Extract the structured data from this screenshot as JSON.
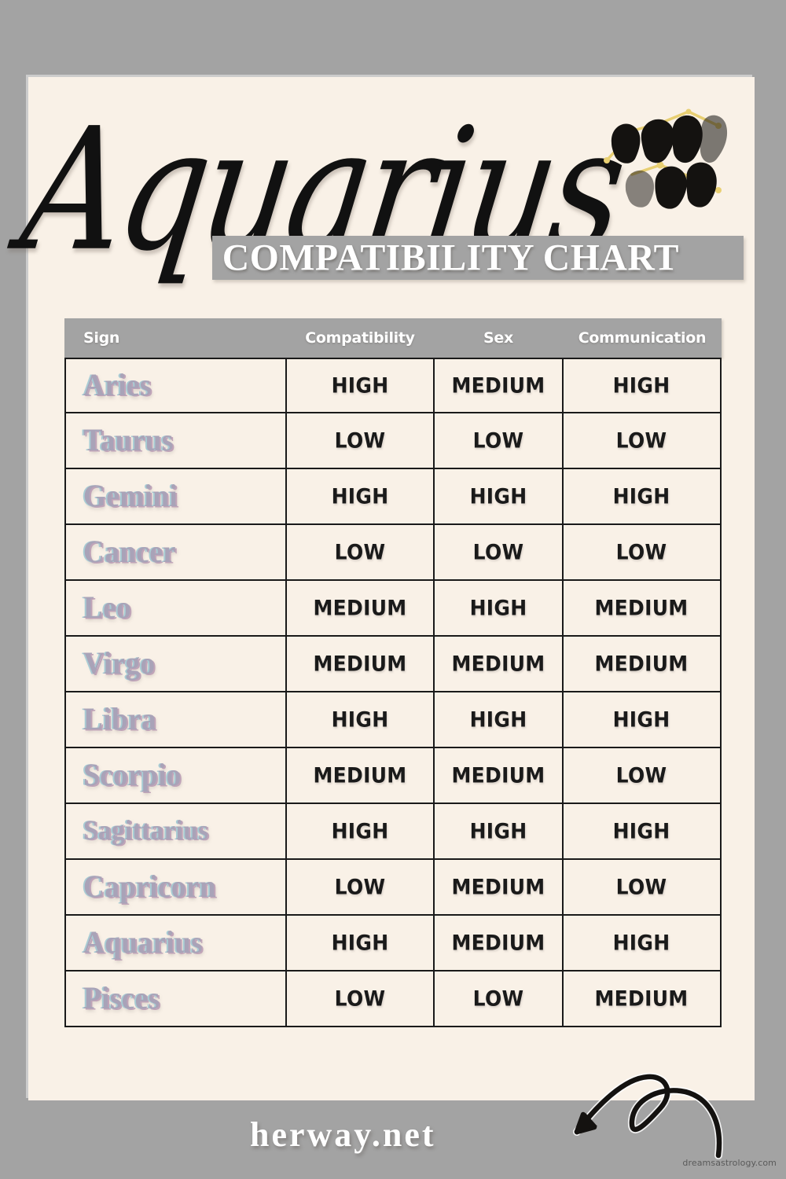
{
  "title": {
    "script": "Aquarius",
    "banner": "COMPATIBILITY CHART",
    "glyph_icon": "aquarius-zodiac-glyph"
  },
  "table": {
    "columns": [
      "Sign",
      "Compatibility",
      "Sex",
      "Communication"
    ],
    "rows": [
      {
        "sign": "Aries",
        "compatibility": "HIGH",
        "sex": "MEDIUM",
        "communication": "HIGH"
      },
      {
        "sign": "Taurus",
        "compatibility": "LOW",
        "sex": "LOW",
        "communication": "LOW"
      },
      {
        "sign": "Gemini",
        "compatibility": "HIGH",
        "sex": "HIGH",
        "communication": "HIGH"
      },
      {
        "sign": "Cancer",
        "compatibility": "LOW",
        "sex": "LOW",
        "communication": "LOW"
      },
      {
        "sign": "Leo",
        "compatibility": "MEDIUM",
        "sex": "HIGH",
        "communication": "MEDIUM"
      },
      {
        "sign": "Virgo",
        "compatibility": "MEDIUM",
        "sex": "MEDIUM",
        "communication": "MEDIUM"
      },
      {
        "sign": "Libra",
        "compatibility": "HIGH",
        "sex": "HIGH",
        "communication": "HIGH"
      },
      {
        "sign": "Scorpio",
        "compatibility": "MEDIUM",
        "sex": "MEDIUM",
        "communication": "LOW"
      },
      {
        "sign": "Sagittarius",
        "compatibility": "HIGH",
        "sex": "HIGH",
        "communication": "HIGH"
      },
      {
        "sign": "Capricorn",
        "compatibility": "LOW",
        "sex": "MEDIUM",
        "communication": "LOW"
      },
      {
        "sign": "Aquarius",
        "compatibility": "HIGH",
        "sex": "MEDIUM",
        "communication": "HIGH"
      },
      {
        "sign": "Pisces",
        "compatibility": "LOW",
        "sex": "LOW",
        "communication": "MEDIUM"
      }
    ]
  },
  "footer": {
    "brand": "herway.net",
    "watermark": "dreamsastrology.com",
    "arrow_icon": "curly-arrow-down-left-icon"
  },
  "colors": {
    "outer_background": "#a3a3a3",
    "card_background": "#f9f1e7",
    "banner_background": "#a3a3a3",
    "banner_text": "#ffffff",
    "sign_text": "#a9a3b8",
    "sign_shadow_cyan": "#a8ccd4",
    "sign_shadow_mauve": "#c0a4b8",
    "value_text": "#1a1a1a",
    "grid_line": "#1a1a1a",
    "glyph_black": "#141210",
    "glyph_gold": "#e8cf72"
  },
  "chart_data": {
    "type": "table",
    "title": "Aquarius Compatibility Chart",
    "columns": [
      "Sign",
      "Compatibility",
      "Sex",
      "Communication"
    ],
    "categories": [
      "Aries",
      "Taurus",
      "Gemini",
      "Cancer",
      "Leo",
      "Virgo",
      "Libra",
      "Scorpio",
      "Sagittarius",
      "Capricorn",
      "Aquarius",
      "Pisces"
    ],
    "series": [
      {
        "name": "Compatibility",
        "values": [
          "HIGH",
          "LOW",
          "HIGH",
          "LOW",
          "MEDIUM",
          "MEDIUM",
          "HIGH",
          "MEDIUM",
          "HIGH",
          "LOW",
          "HIGH",
          "LOW"
        ]
      },
      {
        "name": "Sex",
        "values": [
          "MEDIUM",
          "LOW",
          "HIGH",
          "LOW",
          "HIGH",
          "MEDIUM",
          "HIGH",
          "MEDIUM",
          "HIGH",
          "MEDIUM",
          "MEDIUM",
          "LOW"
        ]
      },
      {
        "name": "Communication",
        "values": [
          "HIGH",
          "LOW",
          "HIGH",
          "LOW",
          "MEDIUM",
          "MEDIUM",
          "HIGH",
          "LOW",
          "HIGH",
          "LOW",
          "HIGH",
          "MEDIUM"
        ]
      }
    ],
    "scale": [
      "LOW",
      "MEDIUM",
      "HIGH"
    ],
    "xlabel": "Sign",
    "ylabel": "",
    "legend": "none",
    "grid": true
  }
}
